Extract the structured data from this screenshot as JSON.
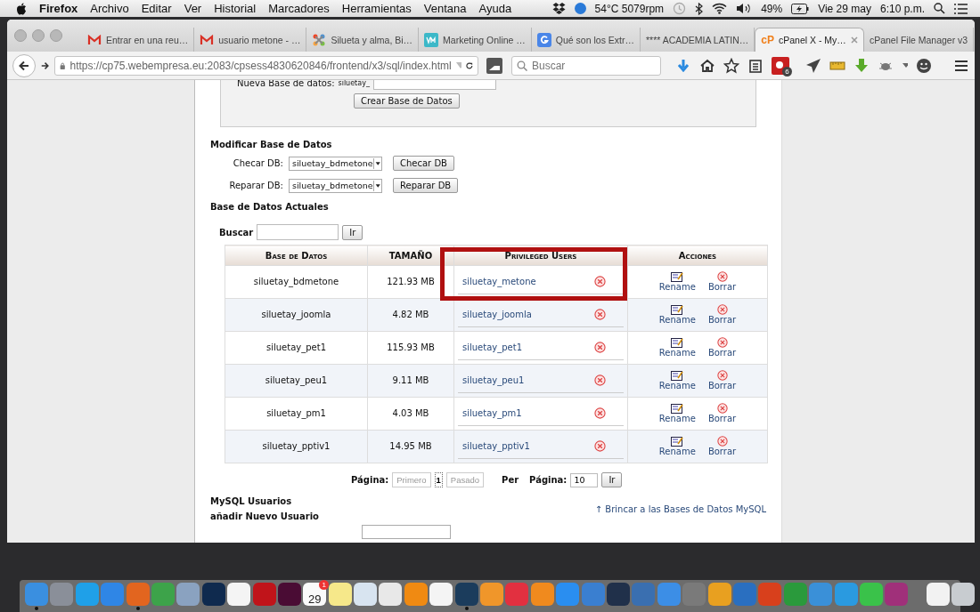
{
  "menu_bar": {
    "app": "Firefox",
    "menus": [
      "Archivo",
      "Editar",
      "Ver",
      "Historial",
      "Marcadores",
      "Herramientas",
      "Ventana",
      "Ayuda"
    ],
    "sensors": "54°C 5079rpm",
    "battery": "49%",
    "date": "Vie 29 may",
    "time": "6:10 p.m."
  },
  "tabs": [
    {
      "label": "Entrar en una reu…",
      "kind": "gmail",
      "selected": false
    },
    {
      "label": "usuario metone - …",
      "kind": "gmail",
      "selected": false
    },
    {
      "label": "Silueta y alma, Bi…",
      "kind": "joomla",
      "selected": false
    },
    {
      "label": "Marketing Online …",
      "kind": "vm",
      "selected": false
    },
    {
      "label": "Qué son los Extr…",
      "kind": "google",
      "selected": false
    },
    {
      "label": "**** ACADEMIA LATIN…",
      "kind": "none",
      "selected": false
    },
    {
      "label": "cPanel X - My…",
      "kind": "cpanel",
      "logo": "cP",
      "selected": true
    },
    {
      "label": "cPanel File Manager v3",
      "kind": "none",
      "selected": false
    }
  ],
  "toolbar": {
    "url": "https://cp75.webempresa.eu:2083/cpsess4830620846/frontend/x3/sql/index.html",
    "search_placeholder": "Buscar",
    "extension_badge": "6"
  },
  "new_db": {
    "label": "Nueva Base de datos:",
    "prefix": "siluetay_",
    "button": "Crear Base de Datos"
  },
  "modify": {
    "title": "Modificar Base de Datos",
    "rows": [
      {
        "label": "Checar DB:",
        "value": "siluetay_bdmetone",
        "button": "Checar DB"
      },
      {
        "label": "Reparar DB:",
        "value": "siluetay_bdmetone",
        "button": "Reparar DB"
      }
    ]
  },
  "current": {
    "title": "Base de Datos Actuales",
    "search_label": "Buscar",
    "search_button": "Ir",
    "columns": [
      "Base de Datos",
      "TAMAÑO",
      "Privileged Users",
      "Acciones"
    ],
    "rows": [
      {
        "database": "siluetay_bdmetone",
        "size": "121.93 MB",
        "user": "siluetay_metone",
        "rename": "Rename",
        "delete": "Borrar",
        "highlighted": true
      },
      {
        "database": "siluetay_joomla",
        "size": "4.82 MB",
        "user": "siluetay_joomla",
        "rename": "Rename",
        "delete": "Borrar",
        "highlighted": false
      },
      {
        "database": "siluetay_pet1",
        "size": "115.93 MB",
        "user": "siluetay_pet1",
        "rename": "Rename",
        "delete": "Borrar",
        "highlighted": false
      },
      {
        "database": "siluetay_peu1",
        "size": "9.11 MB",
        "user": "siluetay_peu1",
        "rename": "Rename",
        "delete": "Borrar",
        "highlighted": false
      },
      {
        "database": "siluetay_pm1",
        "size": "4.03 MB",
        "user": "siluetay_pm1",
        "rename": "Rename",
        "delete": "Borrar",
        "highlighted": false
      },
      {
        "database": "siluetay_pptiv1",
        "size": "14.95 MB",
        "user": "siluetay_pptiv1",
        "rename": "Rename",
        "delete": "Borrar",
        "highlighted": false
      }
    ]
  },
  "pagination": {
    "label": "Página:",
    "pages": [
      {
        "label": "Primero",
        "disabled": true,
        "selected": false
      },
      {
        "label": "1",
        "disabled": false,
        "selected": true
      },
      {
        "label": "Pasado",
        "disabled": true,
        "selected": false
      }
    ],
    "per_label": "Per",
    "per_page_label": "Página:",
    "per_page": "10",
    "go": "Ir"
  },
  "users": {
    "title": "MySQL Usuarios",
    "subtitle": "añadir Nuevo Usuario",
    "jump_link": "↑ Brincar a las Bases de Datos MySQL"
  },
  "dock": [
    {
      "kind": "app",
      "color": "#3a8fe0",
      "running": true
    },
    {
      "kind": "app",
      "color": "#8a8f99",
      "running": false
    },
    {
      "kind": "app",
      "color": "#1fa0e8",
      "running": false
    },
    {
      "kind": "app",
      "color": "#2f86e6",
      "running": false
    },
    {
      "kind": "app",
      "color": "#e2651f",
      "running": true
    },
    {
      "kind": "app",
      "color": "#3da34a",
      "running": false
    },
    {
      "kind": "app",
      "color": "#8aa2c0",
      "running": false
    },
    {
      "kind": "app",
      "color": "#0f2a4e",
      "running": false
    },
    {
      "kind": "app",
      "color": "#f4f4f4",
      "running": false
    },
    {
      "kind": "app",
      "color": "#c0141a",
      "running": false
    },
    {
      "kind": "app",
      "color": "#4a0c34",
      "running": false
    },
    {
      "kind": "calendar",
      "day": "29",
      "badge": "1",
      "color": "#fafafa",
      "running": false
    },
    {
      "kind": "app",
      "color": "#f6e88a",
      "running": false
    },
    {
      "kind": "app",
      "color": "#d8e4f0",
      "running": false
    },
    {
      "kind": "app",
      "color": "#e8e8e8",
      "running": false
    },
    {
      "kind": "app",
      "color": "#f08a12",
      "running": false
    },
    {
      "kind": "app",
      "color": "#f4f4f4",
      "running": false
    },
    {
      "kind": "app",
      "color": "#1b3c5c",
      "running": true
    },
    {
      "kind": "app",
      "color": "#f0962a",
      "running": false
    },
    {
      "kind": "app",
      "color": "#e23040",
      "running": false
    },
    {
      "kind": "app",
      "color": "#f08a1e",
      "running": false
    },
    {
      "kind": "app",
      "color": "#2a8ef0",
      "running": false
    },
    {
      "kind": "app",
      "color": "#3a7fd0",
      "running": false
    },
    {
      "kind": "app",
      "color": "#20304a",
      "running": false
    },
    {
      "kind": "app",
      "color": "#3a6fb0",
      "running": false
    },
    {
      "kind": "app",
      "color": "#3c8ee6",
      "running": false
    },
    {
      "kind": "app",
      "color": "#7a7a7a",
      "running": false
    },
    {
      "kind": "app",
      "color": "#e8a020",
      "running": false
    },
    {
      "kind": "app",
      "color": "#2a6fc0",
      "running": false
    },
    {
      "kind": "app",
      "color": "#d8401c",
      "running": false
    },
    {
      "kind": "app",
      "color": "#2a9a3c",
      "running": false
    },
    {
      "kind": "app",
      "color": "#3a90d8",
      "running": false
    },
    {
      "kind": "app",
      "color": "#2a9ae0",
      "running": false
    },
    {
      "kind": "app",
      "color": "#3ac24a",
      "running": false
    },
    {
      "kind": "app",
      "color": "#a0307a",
      "running": false
    },
    {
      "kind": "separator"
    },
    {
      "kind": "app",
      "color": "#f2f2f2",
      "running": false
    },
    {
      "kind": "app",
      "color": "#c8ccd0",
      "running": false
    }
  ]
}
